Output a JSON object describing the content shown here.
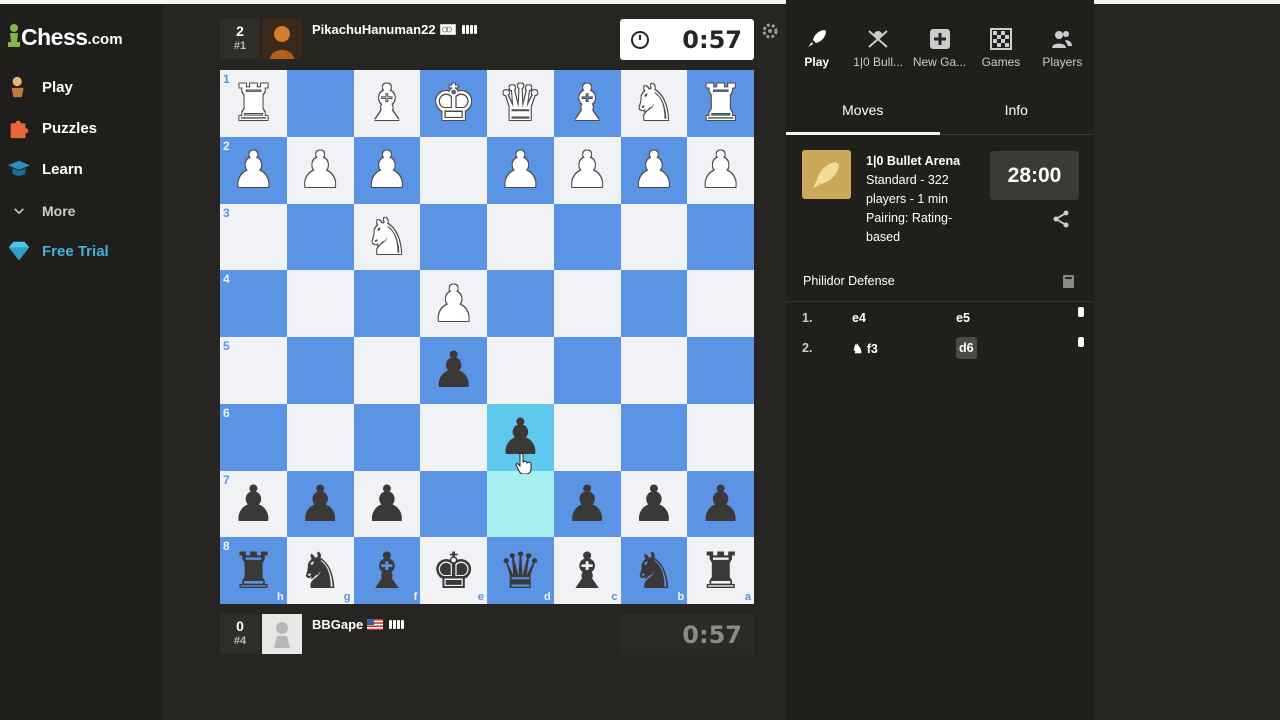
{
  "nav": {
    "logo": "Chess",
    "logo_suffix": ".com",
    "items": [
      {
        "label": "Play",
        "icon": "pawn-hand-icon"
      },
      {
        "label": "Puzzles",
        "icon": "puzzle-icon"
      },
      {
        "label": "Learn",
        "icon": "graduation-cap-icon"
      },
      {
        "label": "More",
        "icon": "chevron-down-icon"
      },
      {
        "label": "Free Trial",
        "icon": "diamond-icon"
      }
    ]
  },
  "top_player": {
    "rank_score": "2",
    "rank_place": "#1",
    "name": "PikachuHanuman22",
    "clock": "0:57"
  },
  "bottom_player": {
    "rank_score": "0",
    "rank_place": "#4",
    "name": "BBGape",
    "clock": "0:57"
  },
  "board": {
    "rank_labels": [
      "1",
      "2",
      "3",
      "4",
      "5",
      "6",
      "7",
      "8"
    ],
    "file_labels": [
      "h",
      "g",
      "f",
      "e",
      "d",
      "c",
      "b",
      "a"
    ],
    "rows": [
      [
        "wR",
        "",
        "wB",
        "wK",
        "wQ",
        "wB",
        "wN",
        "wR"
      ],
      [
        "wP",
        "wP",
        "wP",
        "",
        "wP",
        "wP",
        "wP",
        "wP"
      ],
      [
        "",
        "",
        "wN",
        "",
        "",
        "",
        "",
        ""
      ],
      [
        "",
        "",
        "",
        "wP",
        "",
        "",
        "",
        ""
      ],
      [
        "",
        "",
        "",
        "bP",
        "",
        "",
        "",
        ""
      ],
      [
        "",
        "",
        "",
        "",
        "bP",
        "",
        "",
        ""
      ],
      [
        "bP",
        "bP",
        "bP",
        "",
        "",
        "bP",
        "bP",
        "bP"
      ],
      [
        "bR",
        "bN",
        "bB",
        "bK",
        "bQ",
        "bB",
        "bN",
        "bR"
      ]
    ],
    "colors": {
      "light": "#f0f2f6",
      "dark": "#5b93e5",
      "highlight_from": "#a6eef0",
      "highlight_to": "#5ec9ec"
    }
  },
  "right_panel": {
    "tabs": [
      {
        "label": "Play",
        "icon": "rocket-icon"
      },
      {
        "label": "1|0 Bull...",
        "icon": "bullet-arena-icon"
      },
      {
        "label": "New Ga...",
        "icon": "plus-square-icon"
      },
      {
        "label": "Games",
        "icon": "board-grid-icon"
      },
      {
        "label": "Players",
        "icon": "players-icon"
      }
    ],
    "subtabs": [
      "Moves",
      "Info"
    ],
    "arena": {
      "title": "1|0 Bullet Arena",
      "line1": "Standard - 322",
      "line2": "players - 1 min",
      "line3": "Pairing: Rating-",
      "line4": "based",
      "clock": "28:00"
    },
    "opening": "Philidor Defense",
    "moves": [
      {
        "num": "1.",
        "white": "e4",
        "black": "e5"
      },
      {
        "num": "2.",
        "white": "f3",
        "black": "d6"
      }
    ]
  }
}
